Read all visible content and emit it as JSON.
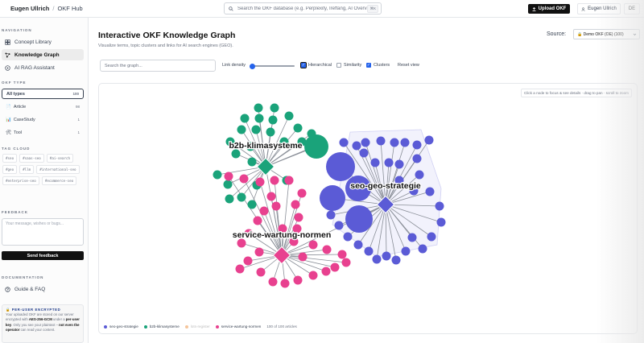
{
  "header": {
    "brand": "Eugen Ullrich",
    "hub": "OKF Hub",
    "search_placeholder": "Search the OKF database (e.g. Perplexity, Ireffang, AI Overvie",
    "kbd": "⌘K",
    "upload_label": "Upload OKF",
    "user_label": "Eugen Ullrich",
    "lang": "DE"
  },
  "sidebar": {
    "nav_heading": "NAVIGATION",
    "nav": [
      {
        "label": "Concept Library",
        "icon": "library-icon"
      },
      {
        "label": "Knowledge Graph",
        "icon": "graph-icon"
      },
      {
        "label": "AI RAG Assistant",
        "icon": "assistant-icon"
      }
    ],
    "type_heading": "OKF TYPE",
    "types": [
      {
        "label": "All types",
        "count": "100",
        "icon": ""
      },
      {
        "label": "Article",
        "count": "98",
        "icon": "📄"
      },
      {
        "label": "CaseStudy",
        "count": "1",
        "icon": "📊"
      },
      {
        "label": "Tool",
        "count": "1",
        "icon": "🛠"
      }
    ],
    "tag_heading": "TAG CLOUD",
    "tags": [
      "#seo",
      "#saas-seo",
      "#ai-search",
      "#geo",
      "#llm",
      "#international-seo",
      "#enterprise-seo",
      "#ecommerce-seo"
    ],
    "feedback_heading": "FEEDBACK",
    "feedback_placeholder": "Your message, wishes or bugs...",
    "send_label": "Send feedback",
    "doc_heading": "DOCUMENTATION",
    "guide_label": "Guide & FAQ",
    "encryption": {
      "heading": "🔒 PER-USER ENCRYPTED",
      "line1": "Your uploaded OKF are stored on our server encrypted with ",
      "alg": "AES-256-GCM",
      "line2": " under a ",
      "key": "per-user key",
      "line3": ". Only you see your plaintext – ",
      "op": "not even the operator",
      "line4": " can read your content."
    }
  },
  "main": {
    "title": "Interactive OKF Knowledge Graph",
    "subtitle": "Visualize terms, topic clusters and links for AI search engines (GEO).",
    "source_label": "Source:",
    "source_value": "🔒 Demo OKF (OE) (100)",
    "graph_search_placeholder": "Search the graph...",
    "link_density_label": "Link density",
    "link_density": 0.05,
    "checks": [
      {
        "label": "Hierarchical",
        "checked": true
      },
      {
        "label": "Similarity",
        "checked": false
      },
      {
        "label": "Clusters",
        "checked": true
      }
    ],
    "reset_label": "Reset view",
    "hint": "Click a node to focus & see details · drag to pan · scroll to zoom",
    "legend": [
      {
        "label": "seo-geo-strategie",
        "color": "#5b5bd6",
        "dim": false
      },
      {
        "label": "b2b-klimasysteme",
        "color": "#1aa37a",
        "dim": false
      },
      {
        "label": "lots-register",
        "color": "#f5c59b",
        "dim": true
      },
      {
        "label": "service-wartung-normen",
        "color": "#e8418f",
        "dim": false
      }
    ],
    "count_text": "100 of 100 articles",
    "clusters": [
      {
        "label": "b2b-klimasysteme",
        "color": "#1aa37a"
      },
      {
        "label": "seo-geo-strategie",
        "color": "#5b5bd6"
      },
      {
        "label": "service-wartung-normen",
        "color": "#e8418f"
      }
    ]
  }
}
